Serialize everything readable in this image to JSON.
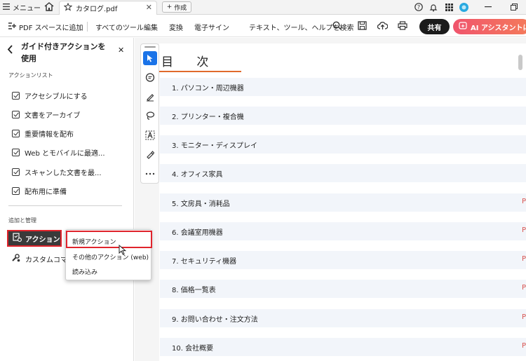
{
  "tabbar": {
    "menu_label": "メニュー",
    "document_tab": "カタログ.pdf",
    "new_button": "作成"
  },
  "toolbar": {
    "add_to_pdf_space": "PDF スペースに追加",
    "all_tools": "すべてのツール",
    "edit": "編集",
    "convert": "変換",
    "e_sign": "電子サイン",
    "search_placeholder": "テキスト、ツール、ヘルプを検索",
    "share": "共有",
    "ai_assistant": "AI アシスタントに質"
  },
  "sidebar": {
    "title": "ガイド付きアクションを使用",
    "action_list_heading": "アクションリスト",
    "actions": [
      "アクセシブルにする",
      "文書をアーカイブ",
      "重要情報を配布",
      "Web とモバイルに最適...",
      "スキャンした文書を最...",
      "配布用に準備"
    ],
    "manage_heading": "追加と管理",
    "action_button": "アクション",
    "custom_command": "カスタムコマンド"
  },
  "popup_menu": {
    "items": [
      "新規アクション",
      "その他のアクション (web)",
      "読み込み"
    ]
  },
  "document": {
    "toc_title": "目 次",
    "entries": [
      "1. パソコン・周辺機器",
      "2. プリンター・複合機",
      "3. モニター・ディスプレイ",
      "4. オフィス家具",
      "5. 文房具・消耗品",
      "6. 会議室用機器",
      "7. セキュリティ機器",
      "8. 価格一覧表",
      "9. お問い合わせ・注文方法",
      "10. 会社概要"
    ],
    "page_marks": [
      "",
      "",
      "",
      "",
      "P",
      "P",
      "P",
      "P",
      "P",
      "P"
    ]
  },
  "colors": {
    "highlight_red": "#e0242c",
    "toc_underline": "#e06a2c",
    "selected_tool": "#1a73e8",
    "ai_gradient_start": "#f0556d"
  }
}
